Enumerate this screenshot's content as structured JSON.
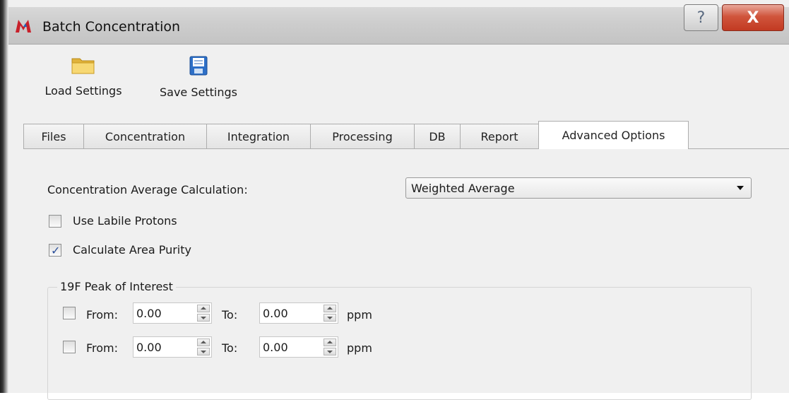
{
  "window": {
    "title": "Batch Concentration",
    "help_symbol": "?",
    "close_symbol": "X"
  },
  "toolbar": {
    "load_label": "Load Settings",
    "save_label": "Save Settings"
  },
  "tabs": [
    {
      "label": "Files",
      "active": false
    },
    {
      "label": "Concentration",
      "active": false
    },
    {
      "label": "Integration",
      "active": false
    },
    {
      "label": "Processing",
      "active": false
    },
    {
      "label": "DB",
      "active": false
    },
    {
      "label": "Report",
      "active": false
    },
    {
      "label": "Advanced Options",
      "active": true
    }
  ],
  "advanced": {
    "avg_calc_label": "Concentration Average Calculation:",
    "avg_calc_value": "Weighted Average",
    "labile_label": "Use Labile Protons",
    "labile_checked": false,
    "purity_label": "Calculate Area Purity",
    "purity_checked": true,
    "peak_group_title": "19F Peak of Interest",
    "ranges": [
      {
        "checked": false,
        "from_label": "From:",
        "from_value": "0.00",
        "to_label": "To:",
        "to_value": "0.00",
        "unit": "ppm"
      },
      {
        "checked": false,
        "from_label": "From:",
        "from_value": "0.00",
        "to_label": "To:",
        "to_value": "0.00",
        "unit": "ppm"
      }
    ]
  },
  "colors": {
    "close_button": "#c94a31",
    "checkmark": "#2b4f9a",
    "folder": "#f2c94c",
    "save_icon": "#2d6fc7"
  }
}
